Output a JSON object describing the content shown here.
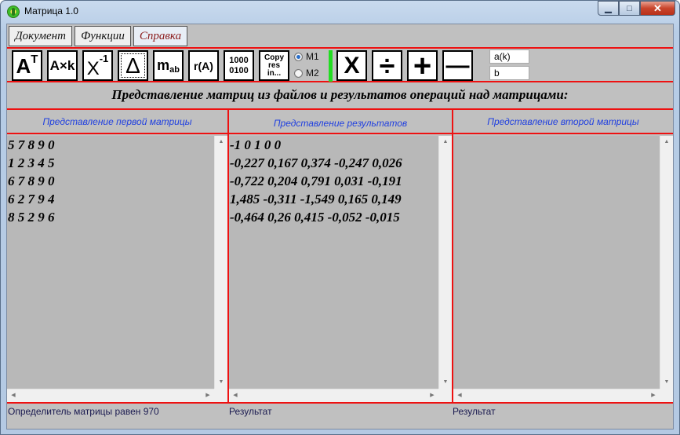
{
  "window": {
    "title": "Матрица 1.0",
    "min_label": "▁",
    "max_label": "□",
    "close_label": "✕"
  },
  "menu": {
    "items": [
      {
        "label": "Документ"
      },
      {
        "label": "Функции"
      },
      {
        "label": "Справка"
      }
    ]
  },
  "toolbar": {
    "transpose_base": "A",
    "transpose_sup": "T",
    "scale_label": "A×k",
    "inverse_base": "X",
    "inverse_sup": "-1",
    "determinant_label": "Δ",
    "minor_base": "m",
    "minor_sub": "ab",
    "rank_label": "r(A)",
    "binary_line1": "1000",
    "binary_line2": "0100",
    "copy_line1": "Copy",
    "copy_line2": "res",
    "copy_line3": "in...",
    "radio_m1": "M1",
    "radio_m2": "M2",
    "multiply_label": "X",
    "divide_label": "÷",
    "add_label": "+",
    "subtract_label": "—",
    "input_k_value": "a(k)",
    "input_b_value": "b"
  },
  "heading": "Представление матриц из файлов и результатов операций над матрицами:",
  "panels": {
    "first": {
      "header": "Представление первой матрицы",
      "rows": [
        "5 7 8 9 0",
        "1 2 3 4 5",
        "6 7 8 9 0",
        "6 2 7 9 4",
        "8 5 2 9 6"
      ]
    },
    "result": {
      "header": "Представление результатов",
      "rows": [
        "-1 0 1 0 0",
        "-0,227 0,167 0,374 -0,247 0,026",
        "-0,722 0,204 0,791 0,031 -0,191",
        "1,485 -0,311 -1,549 0,165 0,149",
        "-0,464 0,26 0,415 -0,052 -0,015"
      ]
    },
    "second": {
      "header": "Представление второй матрицы",
      "rows": []
    }
  },
  "status": {
    "first": "Определитель матрицы равен 970",
    "result": "Результат",
    "second": "Результат"
  },
  "scroll": {
    "up": "▲",
    "down": "▼",
    "left": "◀",
    "right": "▶"
  },
  "colors": {
    "divider": "#ee1111",
    "header_text": "#1f3fe0",
    "accent_bar": "#22dd22"
  }
}
